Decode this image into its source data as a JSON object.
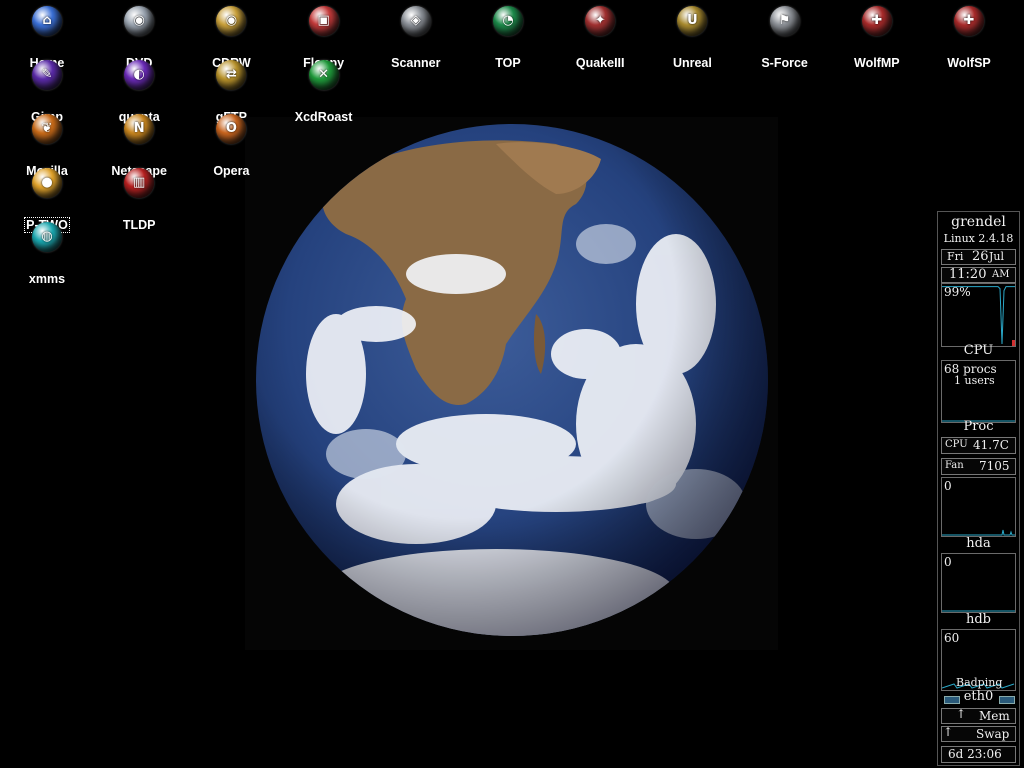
{
  "desktop": {
    "icons": [
      {
        "label": "Home",
        "icon": "home-icon",
        "color": "#3a6fd6",
        "glyph": "⌂"
      },
      {
        "label": "DVD",
        "icon": "dvd-icon",
        "color": "#9aa4b0",
        "glyph": "◉"
      },
      {
        "label": "CDRW",
        "icon": "cdrw-icon",
        "color": "#c9a03a",
        "glyph": "◉"
      },
      {
        "label": "Floppy",
        "icon": "floppy-icon",
        "color": "#c43a3a",
        "glyph": "▣"
      },
      {
        "label": "Scanner",
        "icon": "scanner-icon",
        "color": "#8a8f96",
        "glyph": "◈"
      },
      {
        "label": "TOP",
        "icon": "top-icon",
        "color": "#1c8a4a",
        "glyph": "◔"
      },
      {
        "label": "QuakeIII",
        "icon": "quake-icon",
        "color": "#a03030",
        "glyph": "✦"
      },
      {
        "label": "Unreal",
        "icon": "unreal-icon",
        "color": "#a88a2e",
        "glyph": "U"
      },
      {
        "label": "S-Force",
        "icon": "sforce-icon",
        "color": "#8c9096",
        "glyph": "⚑"
      },
      {
        "label": "WolfMP",
        "icon": "wolf-mp-icon",
        "color": "#a82a2a",
        "glyph": "✚"
      },
      {
        "label": "WolfSP",
        "icon": "wolf-sp-icon",
        "color": "#a82a2a",
        "glyph": "✚"
      },
      {
        "label": "Gimp",
        "icon": "gimp-icon",
        "color": "#5a2aa8",
        "glyph": "✎"
      },
      {
        "label": "quanta",
        "icon": "quanta-icon",
        "color": "#6a2ab8",
        "glyph": "◐"
      },
      {
        "label": "gFTP",
        "icon": "gftp-icon",
        "color": "#b8922a",
        "glyph": "⇄"
      },
      {
        "label": "XcdRoast",
        "icon": "xcdroast-icon",
        "color": "#1e9a3a",
        "glyph": "✕"
      },
      {
        "label": "Mozilla",
        "icon": "mozilla-icon",
        "color": "#c86a18",
        "glyph": "❦"
      },
      {
        "label": "Netscape",
        "icon": "netscape-icon",
        "color": "#c8851e",
        "glyph": "N"
      },
      {
        "label": "Opera",
        "icon": "opera-icon",
        "color": "#c8641e",
        "glyph": "O"
      },
      {
        "label": "P-TWO",
        "icon": "p-two-icon",
        "color": "#e0a22a",
        "glyph": "●"
      },
      {
        "label": "TLDP",
        "icon": "tldp-icon",
        "color": "#b82020",
        "glyph": "▥"
      },
      {
        "label": "xmms",
        "icon": "xmms-icon",
        "color": "#1aa8b0",
        "glyph": "◍"
      }
    ]
  },
  "gkrellm": {
    "hostname": "grendel",
    "kernel": "Linux 2.4.18",
    "date_day": "Fri",
    "date_num": "26",
    "date_month": "Jul",
    "time": "11:20",
    "ampm": "AM",
    "cpu_percent_text": "99%",
    "cpu_label": "CPU",
    "procs_text": "68 procs",
    "users_text": "1 users",
    "proc_label": "Proc",
    "cpu_temp_label": "CPU",
    "cpu_temp_value": "41.7C",
    "fan_label": "Fan",
    "fan_value": "7105",
    "hda_value": "0",
    "hda_label": "hda",
    "hdb_value": "0",
    "hdb_label": "hdb",
    "eth_value": "60",
    "badping_text": "Badping",
    "eth_label": "eth0",
    "mem_label": "Mem",
    "swap_label": "Swap",
    "uptime": "6d 23:06",
    "colors": {
      "graph": "#2aa8c8",
      "accent": "#d03030",
      "border": "#777777"
    },
    "cpu_level": 0.99
  }
}
